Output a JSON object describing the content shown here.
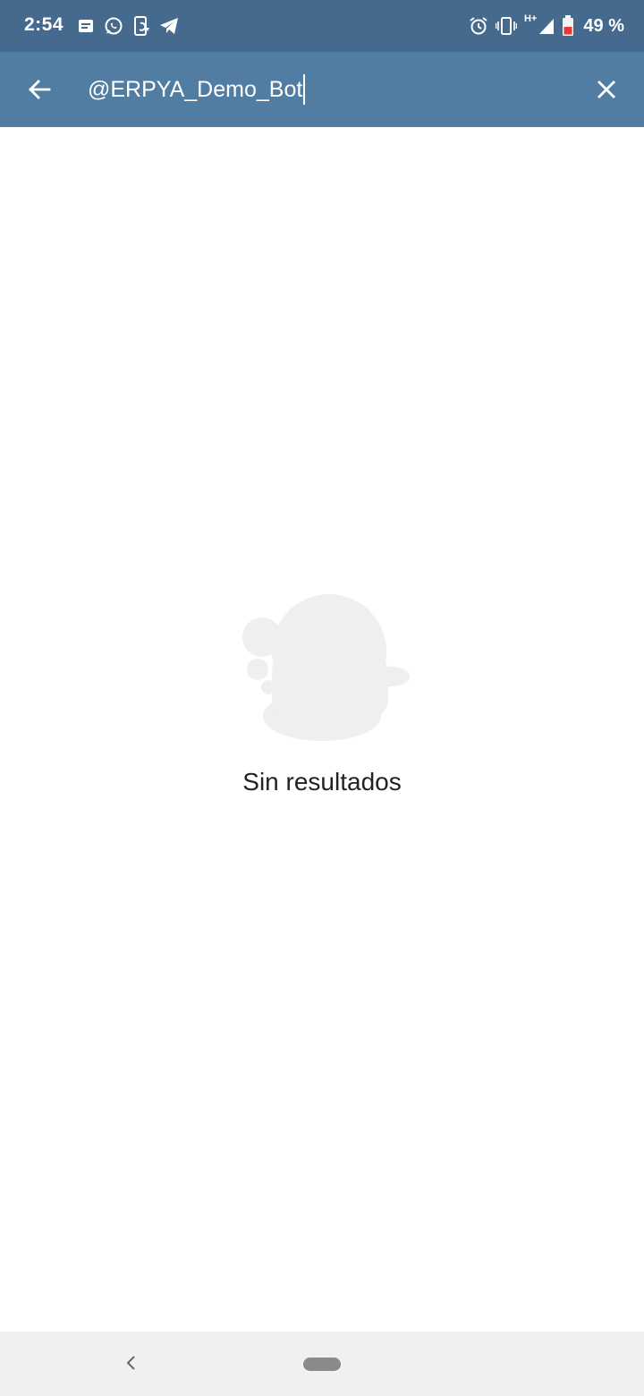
{
  "status_bar": {
    "time": "2:54",
    "battery_text": "49 %",
    "network_label": "H+",
    "left_icons": [
      "message-icon",
      "whatsapp-icon",
      "phone-sync-icon",
      "telegram-icon"
    ],
    "right_icons": [
      "alarm-icon",
      "vibrate-icon",
      "signal-icon",
      "battery-icon"
    ],
    "background_color": "#466a8e"
  },
  "search_bar": {
    "back_icon": "arrow-back-icon",
    "query": "@ERPYA_Demo_Bot",
    "clear_icon": "close-icon",
    "background_color": "#527da3"
  },
  "empty_state": {
    "illustration_icon": "duck-silhouette-icon",
    "message": "Sin resultados"
  },
  "nav_bar": {
    "back_icon": "chevron-left-icon",
    "home_icon": "home-pill-icon"
  }
}
